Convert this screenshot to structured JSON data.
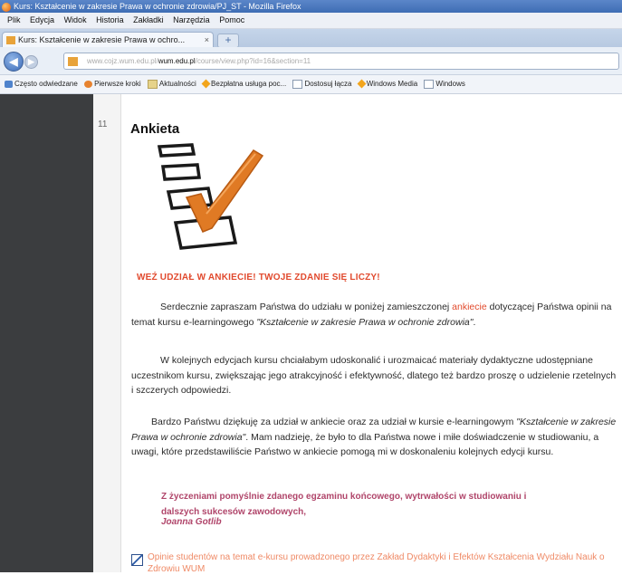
{
  "window": {
    "title": "Kurs: Kształcenie w zakresie Prawa w ochronie zdrowia/PJ_ST - Mozilla Firefox"
  },
  "menu": [
    "Plik",
    "Edycja",
    "Widok",
    "Historia",
    "Zakładki",
    "Narzędzia",
    "Pomoc"
  ],
  "tab": {
    "label": "Kurs: Kształcenie w zakresie Prawa w ochro...",
    "close": "×",
    "new_tab": "+"
  },
  "url": {
    "prefix": "www.cojz.wum.edu.pl/",
    "host": "wum.edu.pl",
    "suffix": "/course/view.php?id=16&section=11"
  },
  "bookmarks": [
    {
      "label": "Często odwiedzane",
      "icon": "blue-icon"
    },
    {
      "label": "Pierwsze kroki",
      "icon": "rss-icon"
    },
    {
      "label": "Aktualności",
      "icon": "folder-icon"
    },
    {
      "label": "Bezpłatna usługa poc...",
      "icon": "star-icon"
    },
    {
      "label": "Dostosuj łącza",
      "icon": "page-icon"
    },
    {
      "label": "Windows Media",
      "icon": "star-icon"
    },
    {
      "label": "Windows",
      "icon": "page-icon"
    }
  ],
  "section": {
    "number": "11",
    "title": "Ankieta"
  },
  "content": {
    "question": "WEŹ UDZIAŁ W ANKIECIE! TWOJE ZDANIE SIĘ LICZY!",
    "p1_a": "Serdecznie zapraszam Państwa do udziału w poniżej zamieszczonej ",
    "p1_link": "ankiecie",
    "p1_b": " dotyczącej Państwa opinii na temat kursu e-learningowego ",
    "p1_course": "\"Kształcenie w zakresie Prawa w ochronie zdrowia\"",
    "p1_c": ".",
    "p2": "W kolejnych edycjach kursu chciałabym udoskonalić i urozmaicać materiały dydaktyczne udostępniane uczestnikom kursu, zwiększając jego atrakcyjność i efektywność, dlatego też bardzo proszę o udzielenie rzetelnych i szczerych odpowiedzi.",
    "p3_a": "Bardzo Państwu dziękuję za udział w ankiecie oraz za udział w kursie e-learningowym ",
    "p3_course": "\"Kształcenie w zakresie Prawa w ochronie zdrowia\"",
    "p3_b": ". Mam nadzieję, że było to dla Państwa nowe i miłe doświadczenie w studiowaniu, a uwagi, które przedstawiliście Państwo w ankiecie pomogą mi w doskonaleniu kolejnych edycji kursu.",
    "wishes": "Z życzeniami pomyślnie zdanego egzaminu końcowego, wytrwałości w studiowaniu i dalszych sukcesów zawodowych,",
    "signature": "Joanna Gotlib",
    "link": "Opinie studentów na temat e-kursu prowadzonego przez Zakład Dydaktyki i Efektów Kształcenia Wydziału Nauk o Zdrowiu WUM"
  }
}
